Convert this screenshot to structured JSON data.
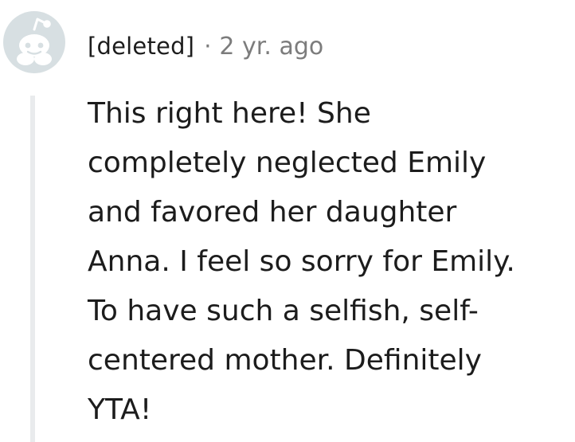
{
  "comment": {
    "author": "[deleted]",
    "separator": "·",
    "time": "2 yr. ago",
    "avatar_icon": "reddit-snoo-avatar-icon",
    "body_lines": [
      "This right here! She",
      "completely neglected Emily",
      "and favored her daughter",
      "Anna. I feel so sorry for Emily.",
      "To have such a selfish, self-",
      "centered mother. Definitely",
      "YTA!"
    ]
  },
  "colors": {
    "text": "#1c1c1c",
    "meta": "#7c7c7c",
    "avatar_bg": "#d7dfe2",
    "thread_line": "#e9ebed"
  }
}
